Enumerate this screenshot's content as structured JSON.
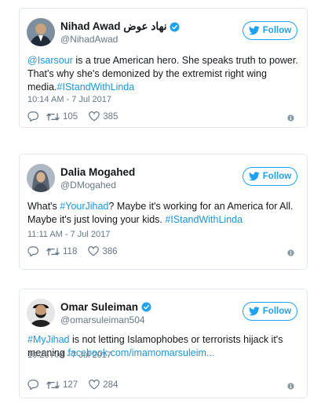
{
  "follow_label": "Follow",
  "colors": {
    "accent": "#1da1f2",
    "link": "#1b95e0",
    "muted": "#657786",
    "border": "#e1e8ed"
  },
  "tweets": [
    {
      "display_name": "Nihad Awad نهاد عوض",
      "verified": true,
      "handle": "@NihadAwad",
      "text_parts": [
        {
          "text": "@Isarsour",
          "link": true
        },
        {
          "text": " is a true American hero. She speaks truth to power. That's why she's demonized by the extremist right wing media.",
          "link": false
        },
        {
          "text": "#IStandWithLinda",
          "link": true
        }
      ],
      "timestamp": "10:14 AM - 7 Jul 2017",
      "retweets": "105",
      "likes": "385"
    },
    {
      "display_name": "Dalia Mogahed",
      "verified": false,
      "handle": "@DMogahed",
      "text_parts": [
        {
          "text": "What's ",
          "link": false
        },
        {
          "text": "#YourJihad",
          "link": true
        },
        {
          "text": "? Maybe it's working for an America for All. Maybe it's just loving your kids. ",
          "link": false
        },
        {
          "text": "#IStandWithLinda",
          "link": true
        }
      ],
      "timestamp": "11:11 AM - 7 Jul 2017",
      "retweets": "118",
      "likes": "386"
    },
    {
      "display_name": "Omar Suleiman",
      "verified": true,
      "handle": "@omarsuleiman504",
      "text_parts": [
        {
          "text": "#MyJihad",
          "link": true
        },
        {
          "text": " is not letting Islamophobes or terrorists hijack it's meaning ",
          "link": false
        },
        {
          "text": "facebook.com/imamomarsuleim...",
          "link": true
        }
      ],
      "timestamp": "10:26 AM - 7 Jul 2017",
      "retweets": "127",
      "likes": "284"
    }
  ]
}
